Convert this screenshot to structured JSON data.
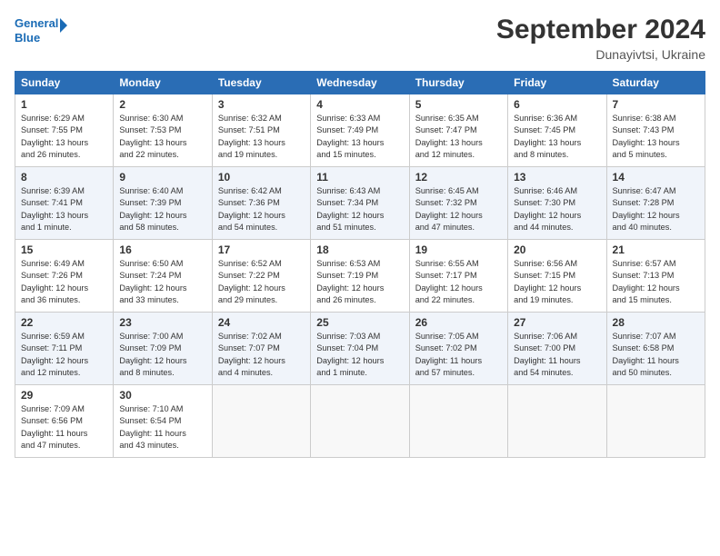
{
  "header": {
    "logo_line1": "General",
    "logo_line2": "Blue",
    "month_title": "September 2024",
    "subtitle": "Dunayivtsi, Ukraine"
  },
  "weekdays": [
    "Sunday",
    "Monday",
    "Tuesday",
    "Wednesday",
    "Thursday",
    "Friday",
    "Saturday"
  ],
  "weeks": [
    [
      {
        "day": "1",
        "info": "Sunrise: 6:29 AM\nSunset: 7:55 PM\nDaylight: 13 hours\nand 26 minutes."
      },
      {
        "day": "2",
        "info": "Sunrise: 6:30 AM\nSunset: 7:53 PM\nDaylight: 13 hours\nand 22 minutes."
      },
      {
        "day": "3",
        "info": "Sunrise: 6:32 AM\nSunset: 7:51 PM\nDaylight: 13 hours\nand 19 minutes."
      },
      {
        "day": "4",
        "info": "Sunrise: 6:33 AM\nSunset: 7:49 PM\nDaylight: 13 hours\nand 15 minutes."
      },
      {
        "day": "5",
        "info": "Sunrise: 6:35 AM\nSunset: 7:47 PM\nDaylight: 13 hours\nand 12 minutes."
      },
      {
        "day": "6",
        "info": "Sunrise: 6:36 AM\nSunset: 7:45 PM\nDaylight: 13 hours\nand 8 minutes."
      },
      {
        "day": "7",
        "info": "Sunrise: 6:38 AM\nSunset: 7:43 PM\nDaylight: 13 hours\nand 5 minutes."
      }
    ],
    [
      {
        "day": "8",
        "info": "Sunrise: 6:39 AM\nSunset: 7:41 PM\nDaylight: 13 hours\nand 1 minute."
      },
      {
        "day": "9",
        "info": "Sunrise: 6:40 AM\nSunset: 7:39 PM\nDaylight: 12 hours\nand 58 minutes."
      },
      {
        "day": "10",
        "info": "Sunrise: 6:42 AM\nSunset: 7:36 PM\nDaylight: 12 hours\nand 54 minutes."
      },
      {
        "day": "11",
        "info": "Sunrise: 6:43 AM\nSunset: 7:34 PM\nDaylight: 12 hours\nand 51 minutes."
      },
      {
        "day": "12",
        "info": "Sunrise: 6:45 AM\nSunset: 7:32 PM\nDaylight: 12 hours\nand 47 minutes."
      },
      {
        "day": "13",
        "info": "Sunrise: 6:46 AM\nSunset: 7:30 PM\nDaylight: 12 hours\nand 44 minutes."
      },
      {
        "day": "14",
        "info": "Sunrise: 6:47 AM\nSunset: 7:28 PM\nDaylight: 12 hours\nand 40 minutes."
      }
    ],
    [
      {
        "day": "15",
        "info": "Sunrise: 6:49 AM\nSunset: 7:26 PM\nDaylight: 12 hours\nand 36 minutes."
      },
      {
        "day": "16",
        "info": "Sunrise: 6:50 AM\nSunset: 7:24 PM\nDaylight: 12 hours\nand 33 minutes."
      },
      {
        "day": "17",
        "info": "Sunrise: 6:52 AM\nSunset: 7:22 PM\nDaylight: 12 hours\nand 29 minutes."
      },
      {
        "day": "18",
        "info": "Sunrise: 6:53 AM\nSunset: 7:19 PM\nDaylight: 12 hours\nand 26 minutes."
      },
      {
        "day": "19",
        "info": "Sunrise: 6:55 AM\nSunset: 7:17 PM\nDaylight: 12 hours\nand 22 minutes."
      },
      {
        "day": "20",
        "info": "Sunrise: 6:56 AM\nSunset: 7:15 PM\nDaylight: 12 hours\nand 19 minutes."
      },
      {
        "day": "21",
        "info": "Sunrise: 6:57 AM\nSunset: 7:13 PM\nDaylight: 12 hours\nand 15 minutes."
      }
    ],
    [
      {
        "day": "22",
        "info": "Sunrise: 6:59 AM\nSunset: 7:11 PM\nDaylight: 12 hours\nand 12 minutes."
      },
      {
        "day": "23",
        "info": "Sunrise: 7:00 AM\nSunset: 7:09 PM\nDaylight: 12 hours\nand 8 minutes."
      },
      {
        "day": "24",
        "info": "Sunrise: 7:02 AM\nSunset: 7:07 PM\nDaylight: 12 hours\nand 4 minutes."
      },
      {
        "day": "25",
        "info": "Sunrise: 7:03 AM\nSunset: 7:04 PM\nDaylight: 12 hours\nand 1 minute."
      },
      {
        "day": "26",
        "info": "Sunrise: 7:05 AM\nSunset: 7:02 PM\nDaylight: 11 hours\nand 57 minutes."
      },
      {
        "day": "27",
        "info": "Sunrise: 7:06 AM\nSunset: 7:00 PM\nDaylight: 11 hours\nand 54 minutes."
      },
      {
        "day": "28",
        "info": "Sunrise: 7:07 AM\nSunset: 6:58 PM\nDaylight: 11 hours\nand 50 minutes."
      }
    ],
    [
      {
        "day": "29",
        "info": "Sunrise: 7:09 AM\nSunset: 6:56 PM\nDaylight: 11 hours\nand 47 minutes."
      },
      {
        "day": "30",
        "info": "Sunrise: 7:10 AM\nSunset: 6:54 PM\nDaylight: 11 hours\nand 43 minutes."
      },
      {
        "day": "",
        "info": ""
      },
      {
        "day": "",
        "info": ""
      },
      {
        "day": "",
        "info": ""
      },
      {
        "day": "",
        "info": ""
      },
      {
        "day": "",
        "info": ""
      }
    ]
  ]
}
